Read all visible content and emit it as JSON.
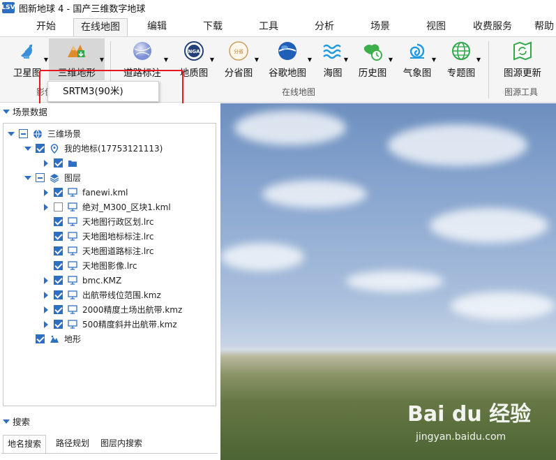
{
  "app": {
    "logo_text": "LSV",
    "title": "图新地球 4 - 国产三维数字地球"
  },
  "menu": {
    "tabs": [
      "开始",
      "在线地图",
      "编辑",
      "下载",
      "工具",
      "分析",
      "场景",
      "视图",
      "收费服务",
      "帮助"
    ],
    "active": "在线地图"
  },
  "ribbon": {
    "buttons": [
      {
        "label": "卫星图",
        "icon": "satellite-dish-icon"
      },
      {
        "label": "三维地形",
        "icon": "terrain-icon"
      },
      {
        "label": "道路标注",
        "icon": "road-label-icon"
      },
      {
        "label": "地质图",
        "icon": "nga-icon",
        "icon_text": "NGA"
      },
      {
        "label": "分省图",
        "icon": "province-map-icon",
        "icon_text": "分省"
      },
      {
        "label": "谷歌地图",
        "icon": "google-globe-icon"
      },
      {
        "label": "海图",
        "icon": "wave-icon"
      },
      {
        "label": "历史图",
        "icon": "history-map-icon"
      },
      {
        "label": "气象图",
        "icon": "weather-swirl-icon"
      },
      {
        "label": "专题图",
        "icon": "theme-globe-icon"
      },
      {
        "label": "图源更新",
        "icon": "map-refresh-icon"
      }
    ],
    "groups": {
      "left": "影像",
      "middle": "在线地图",
      "right": "图源工具"
    },
    "dropdown_item": "SRTM3(90米)"
  },
  "left_panel": {
    "scene_header": "场景数据",
    "tree": [
      {
        "label": "三维场景",
        "icon": "globe-icon",
        "check": "partial",
        "toggle": "down",
        "indent": 0
      },
      {
        "label": "我的地标(17753121113)",
        "icon": "location-pin-icon",
        "check": "checked",
        "toggle": "down",
        "indent": 1
      },
      {
        "label": "",
        "icon": "folder-icon",
        "check": "checked",
        "toggle": "right",
        "indent": 2
      },
      {
        "label": "图层",
        "icon": "layers-icon",
        "check": "partial",
        "toggle": "down",
        "indent": 1
      },
      {
        "label": "fanewi.kml",
        "icon": "monitor-icon",
        "check": "checked",
        "toggle": "right",
        "indent": 2
      },
      {
        "label": "绝对_M300_区块1.kml",
        "icon": "monitor-icon",
        "check": "empty",
        "toggle": "right",
        "indent": 2
      },
      {
        "label": "天地图行政区划.lrc",
        "icon": "monitor-icon",
        "check": "checked",
        "toggle": "none",
        "indent": 2
      },
      {
        "label": "天地图地标标注.lrc",
        "icon": "monitor-icon",
        "check": "checked",
        "toggle": "none",
        "indent": 2
      },
      {
        "label": "天地图道路标注.lrc",
        "icon": "monitor-icon",
        "check": "checked",
        "toggle": "none",
        "indent": 2
      },
      {
        "label": "天地图影像.lrc",
        "icon": "monitor-icon",
        "check": "checked",
        "toggle": "none",
        "indent": 2
      },
      {
        "label": "bmc.KMZ",
        "icon": "monitor-icon",
        "check": "checked",
        "toggle": "right",
        "indent": 2
      },
      {
        "label": "出航带线位范围.kmz",
        "icon": "monitor-icon",
        "check": "checked",
        "toggle": "right",
        "indent": 2
      },
      {
        "label": "2000精度土场出航带.kmz",
        "icon": "monitor-icon",
        "check": "checked",
        "toggle": "right",
        "indent": 2
      },
      {
        "label": "500精度斜井出航带.kmz",
        "icon": "monitor-icon",
        "check": "checked",
        "toggle": "right",
        "indent": 2
      },
      {
        "label": "地形",
        "icon": "terrain-small-icon",
        "check": "checked",
        "toggle": "none",
        "indent": 1
      }
    ],
    "search_header": "搜索",
    "search_tabs": [
      "地名搜索",
      "路径规划",
      "图层内搜索"
    ]
  },
  "watermark": {
    "brand": "Bai du 经验",
    "url": "jingyan.baidu.com"
  },
  "colors": {
    "accent": "#2f6fc2",
    "highlight": "#e8171f"
  }
}
